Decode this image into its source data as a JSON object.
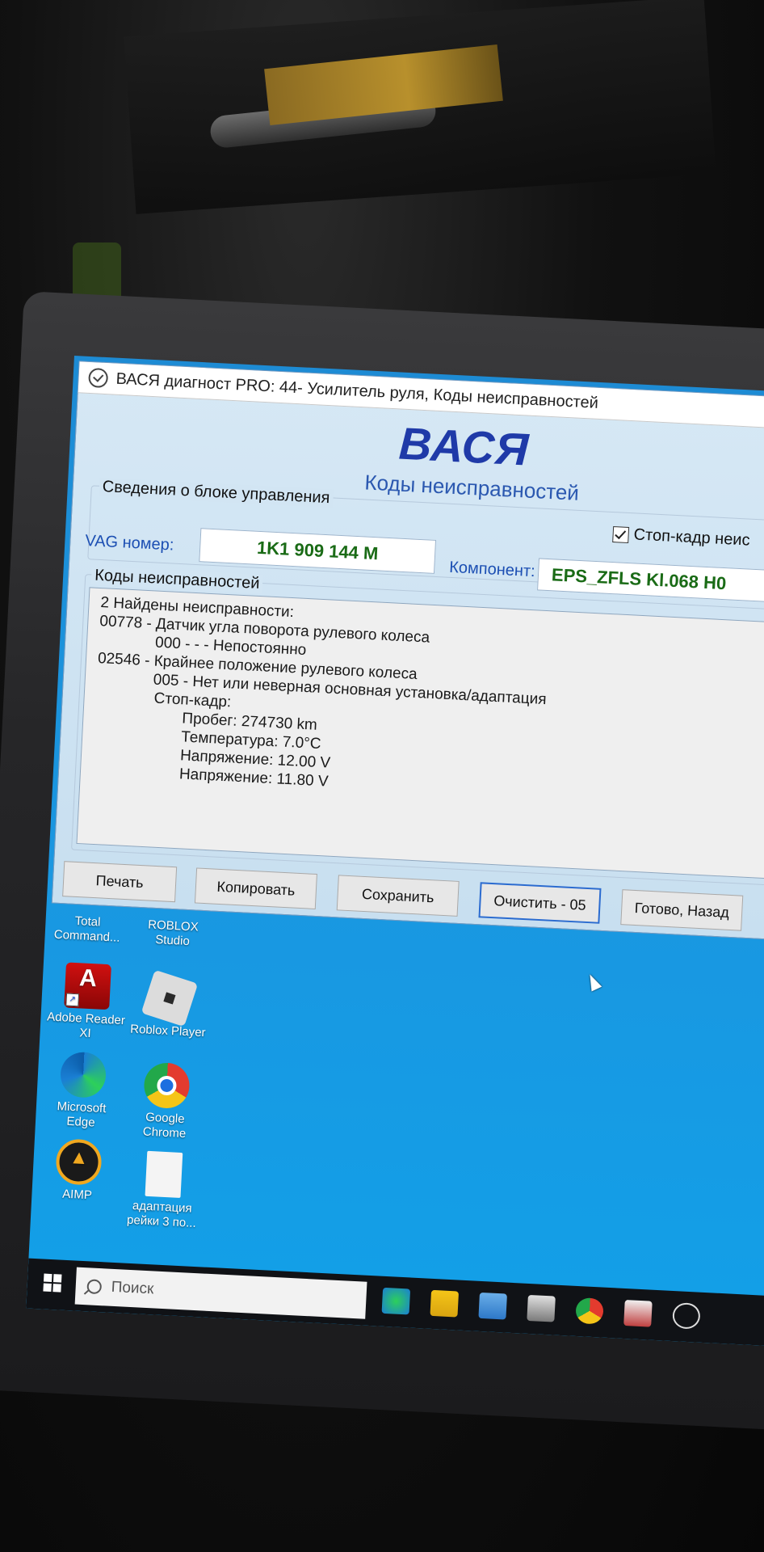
{
  "window": {
    "title": "ВАСЯ диагност PRO: 44- Усилитель руля,  Коды неисправностей"
  },
  "brand": {
    "logo": "ВАСЯ",
    "subtitle": "Коды неисправностей"
  },
  "info_group": {
    "label": "Сведения о блоке управления",
    "vag_label": "VAG номер:",
    "vag_value": "1K1 909 144 M",
    "component_label": "Компонент:",
    "component_value": "EPS_ZFLS Kl.068 H0",
    "freeze_frame_checkbox": "Стоп-кадр неис"
  },
  "codes_group": {
    "label": "Коды неисправностей",
    "lines": [
      "2 Найдены неисправности:",
      "00778 - Датчик угла поворота рулевого колеса",
      "000 - - - Непостоянно",
      "02546 - Крайнее положение рулевого колеса",
      "005 - Нет или неверная основная установка/адаптация",
      "Стоп-кадр:",
      "Пробег: 274730 km",
      "Температура: 7.0°C",
      "Напряжение: 12.00 V",
      "Напряжение: 11.80 V"
    ]
  },
  "buttons": {
    "print": "Печать",
    "copy": "Копировать",
    "save": "Сохранить",
    "clear": "Очистить - 05",
    "done": "Готово, Назад"
  },
  "desktop": {
    "icons": [
      {
        "label": "Total Command...",
        "icon": "total-commander-icon"
      },
      {
        "label": "ROBLOX Studio",
        "icon": "roblox-studio-icon"
      },
      {
        "label": "Adobe Reader XI",
        "icon": "pdf-icon"
      },
      {
        "label": "Roblox Player",
        "icon": "roblox-icon"
      },
      {
        "label": "Microsoft Edge",
        "icon": "edge-icon"
      },
      {
        "label": "Google Chrome",
        "icon": "chrome-icon"
      },
      {
        "label": "AIMP",
        "icon": "aimp-icon"
      },
      {
        "label": "адаптация рейки 3 по...",
        "icon": "file-icon"
      }
    ]
  },
  "taskbar": {
    "search_placeholder": "Поиск"
  },
  "colors": {
    "brand_blue": "#1f3aa8",
    "value_green": "#1a6b16",
    "label_blue": "#1c4fb3",
    "desktop_blue": "#1a96e0"
  }
}
